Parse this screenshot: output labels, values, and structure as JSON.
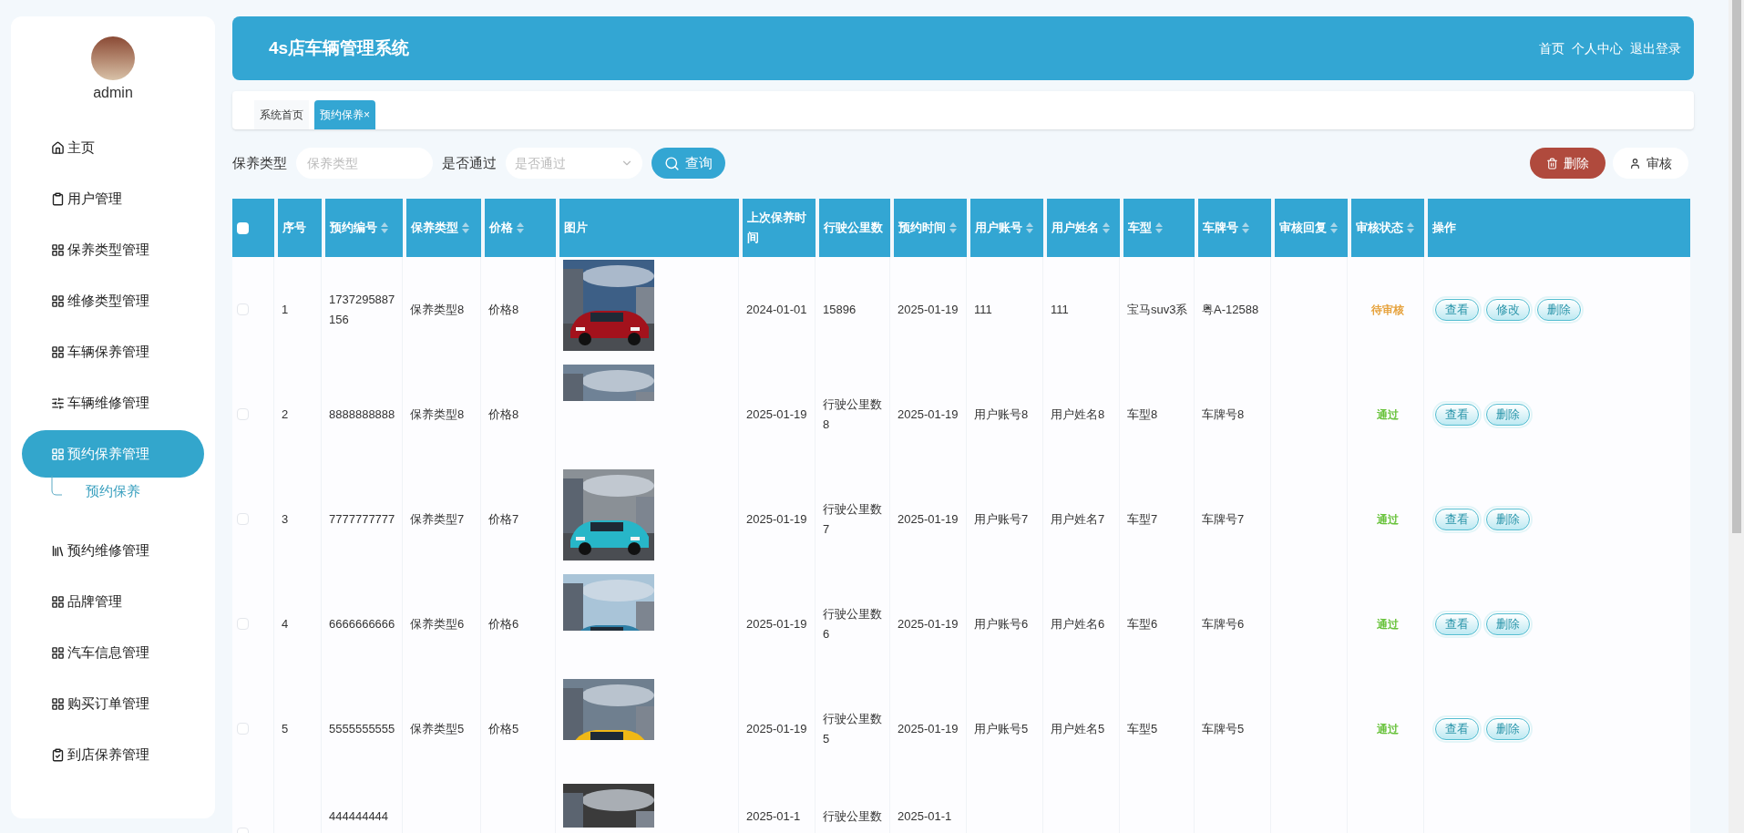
{
  "sidebar": {
    "user": {
      "name": "admin"
    },
    "items": [
      {
        "label": "主页",
        "selected": false
      },
      {
        "label": "用户管理",
        "selected": false
      },
      {
        "label": "保养类型管理",
        "selected": false
      },
      {
        "label": "维修类型管理",
        "selected": false
      },
      {
        "label": "车辆保养管理",
        "selected": false
      },
      {
        "label": "车辆维修管理",
        "selected": false
      },
      {
        "label": "预约保养管理",
        "selected": true,
        "expanded": true,
        "children": [
          {
            "label": "预约保养",
            "selected": true
          }
        ]
      },
      {
        "label": "预约维修管理",
        "selected": false
      },
      {
        "label": "品牌管理",
        "selected": false
      },
      {
        "label": "汽车信息管理",
        "selected": false
      },
      {
        "label": "购买订单管理",
        "selected": false
      },
      {
        "label": "到店保养管理",
        "selected": false
      }
    ]
  },
  "header": {
    "title": "4s店车辆管理系统",
    "links": [
      "首页",
      "个人中心",
      "退出登录"
    ]
  },
  "tabs": [
    {
      "label": "系统首页",
      "selected": false
    },
    {
      "label": "预约保养",
      "selected": true,
      "close": "×"
    }
  ],
  "search": {
    "fields": [
      {
        "kind": "text",
        "label": "保养类型",
        "placeholder": "保养类型"
      },
      {
        "kind": "select",
        "label": "是否通过",
        "placeholder": "是否通过"
      }
    ],
    "button": "查询"
  },
  "actions": [
    {
      "kind": "danger",
      "label": "删除"
    },
    {
      "kind": "plain",
      "label": "审核"
    }
  ],
  "table": {
    "select_all": {
      "checked": false
    },
    "columns": [
      {
        "label": "序号",
        "sortable": false
      },
      {
        "label": "预约编号",
        "sortable": true
      },
      {
        "label": "保养类型",
        "sortable": true
      },
      {
        "label": "价格",
        "sortable": true
      },
      {
        "label": "图片",
        "sortable": false
      },
      {
        "label": "上次保养时间",
        "sortable": false
      },
      {
        "label": "行驶公里数",
        "sortable": false
      },
      {
        "label": "预约时间",
        "sortable": true
      },
      {
        "label": "用户账号",
        "sortable": true
      },
      {
        "label": "用户姓名",
        "sortable": true
      },
      {
        "label": "车型",
        "sortable": true
      },
      {
        "label": "车牌号",
        "sortable": true
      },
      {
        "label": "审核回复",
        "sortable": true
      },
      {
        "label": "审核状态",
        "sortable": true
      },
      {
        "label": "操作",
        "sortable": false
      }
    ],
    "rows": [
      {
        "checked": false,
        "cells": [
          "1",
          "1737295887156",
          "保养类型8",
          "价格8",
          {
            "kind": "picture"
          },
          "2024-01-01",
          "15896",
          "2025-01-19",
          "111",
          "111",
          "宝马suv3系",
          "粤A-12588",
          ""
        ],
        "status": {
          "text": "待审核",
          "color": "#e6a23c"
        },
        "ops": [
          "查看",
          "修改",
          "删除"
        ]
      },
      {
        "checked": false,
        "cells": [
          "2",
          "8888888888",
          "保养类型8",
          "价格8",
          {
            "kind": "picture"
          },
          "2025-01-19",
          "行驶公里数8",
          "2025-01-19",
          "用户账号8",
          "用户姓名8",
          "车型8",
          "车牌号8",
          ""
        ],
        "status": {
          "text": "通过",
          "color": "#67c23a"
        },
        "ops": [
          "查看",
          "删除"
        ]
      },
      {
        "checked": false,
        "cells": [
          "3",
          "7777777777",
          "保养类型7",
          "价格7",
          {
            "kind": "picture"
          },
          "2025-01-19",
          "行驶公里数7",
          "2025-01-19",
          "用户账号7",
          "用户姓名7",
          "车型7",
          "车牌号7",
          ""
        ],
        "status": {
          "text": "通过",
          "color": "#67c23a"
        },
        "ops": [
          "查看",
          "删除"
        ]
      },
      {
        "checked": false,
        "cells": [
          "4",
          "6666666666",
          "保养类型6",
          "价格6",
          {
            "kind": "picture"
          },
          "2025-01-19",
          "行驶公里数6",
          "2025-01-19",
          "用户账号6",
          "用户姓名6",
          "车型6",
          "车牌号6",
          ""
        ],
        "status": {
          "text": "通过",
          "color": "#67c23a"
        },
        "ops": [
          "查看",
          "删除"
        ]
      },
      {
        "checked": false,
        "cells": [
          "5",
          "5555555555",
          "保养类型5",
          "价格5",
          {
            "kind": "picture"
          },
          "2025-01-19",
          "行驶公里数5",
          "2025-01-19",
          "用户账号5",
          "用户姓名5",
          "车型5",
          "车牌号5",
          ""
        ],
        "status": {
          "text": "通过",
          "color": "#67c23a"
        },
        "ops": [
          "查看",
          "删除"
        ]
      },
      {
        "checked": false,
        "cells": [
          "",
          "444444444",
          "",
          "",
          {
            "kind": "picture"
          },
          "2025-01-1",
          "行驶公里数",
          "2025-01-1",
          "",
          "",
          "",
          "",
          ""
        ],
        "ops": []
      }
    ]
  }
}
